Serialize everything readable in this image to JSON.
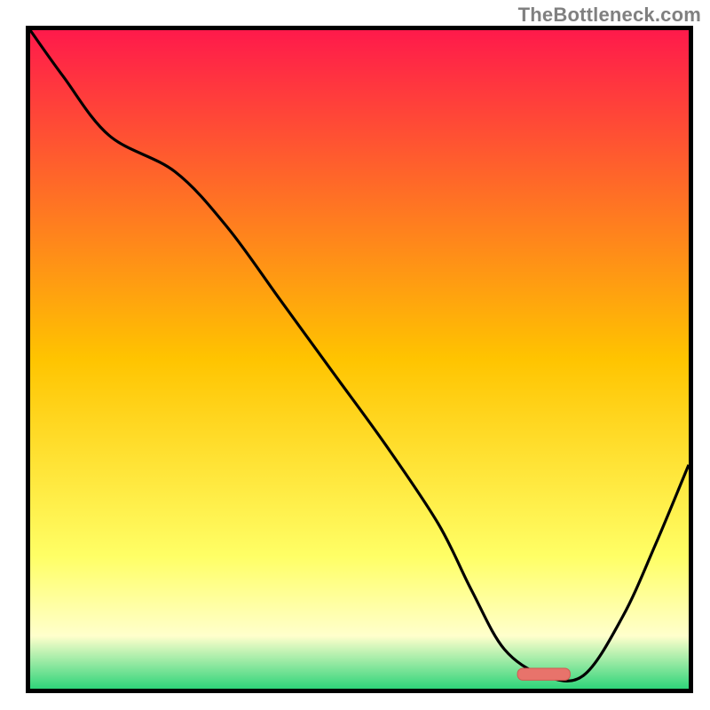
{
  "watermark": "TheBottleneck.com",
  "colors": {
    "frame": "#000000",
    "curve": "#000000",
    "marker_fill": "#e8736b",
    "marker_stroke": "#cf5a52"
  },
  "chart_data": {
    "type": "line",
    "title": "",
    "xlabel": "",
    "ylabel": "",
    "xlim": [
      0,
      100
    ],
    "ylim": [
      0,
      100
    ],
    "grid": false,
    "legend": false,
    "background_gradient": [
      {
        "pos": 0,
        "color": "#ff1a4b"
      },
      {
        "pos": 50,
        "color": "#ffc400"
      },
      {
        "pos": 80,
        "color": "#ffff66"
      },
      {
        "pos": 92,
        "color": "#ffffcc"
      },
      {
        "pos": 100,
        "color": "#2fd47a"
      }
    ],
    "curve": {
      "x": [
        0,
        5,
        12,
        22,
        30,
        38,
        46,
        54,
        62,
        67,
        72,
        78,
        84,
        90,
        95,
        100
      ],
      "y": [
        100,
        93,
        84,
        78.5,
        70,
        59,
        48,
        37,
        25,
        15,
        6,
        2,
        2,
        11,
        22,
        34
      ]
    },
    "marker": {
      "x_center": 78,
      "y": 2.2,
      "width": 8,
      "height": 1.8,
      "shape": "capsule"
    }
  }
}
